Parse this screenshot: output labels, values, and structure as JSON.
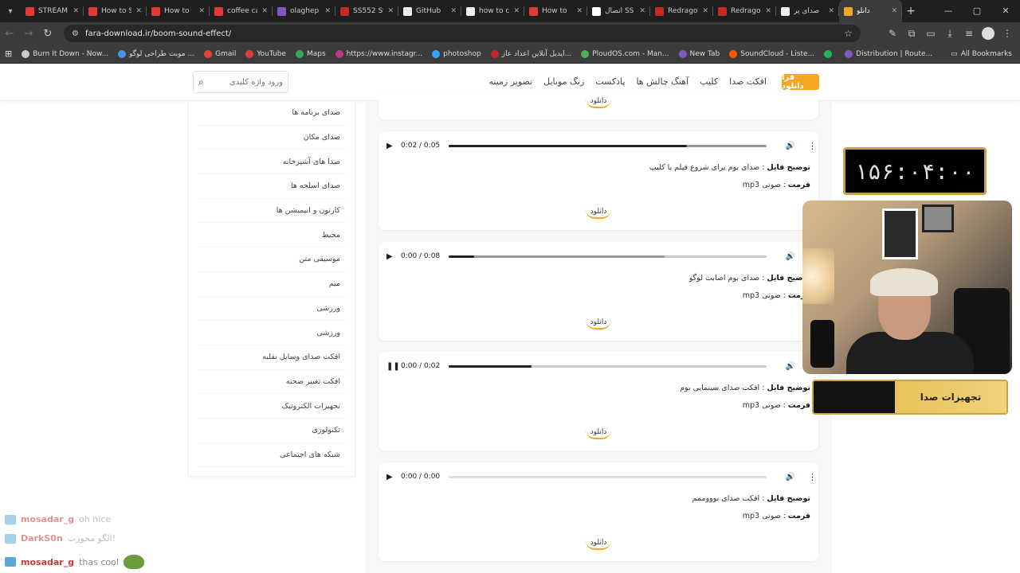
{
  "browser": {
    "tabs": [
      {
        "title": "STREAM",
        "color": "#e53935"
      },
      {
        "title": "How to S",
        "color": "#e53935"
      },
      {
        "title": "How to",
        "color": "#e53935"
      },
      {
        "title": "coffee ca",
        "color": "#e53935"
      },
      {
        "title": "olaghep",
        "color": "#7e57c2"
      },
      {
        "title": "SS552 St",
        "color": "#c62828"
      },
      {
        "title": "GitHub",
        "color": "#eeeeee"
      },
      {
        "title": "how to c",
        "color": "#eeeeee"
      },
      {
        "title": "How to",
        "color": "#e53935"
      },
      {
        "title": "اتصال SS",
        "color": "#ffffff"
      },
      {
        "title": "Redrago",
        "color": "#c62828"
      },
      {
        "title": "Redrago",
        "color": "#c62828"
      },
      {
        "title": "صدای پر",
        "color": "#eeeeee"
      },
      {
        "title": "دانلو",
        "color": "#f5a623",
        "active": true
      }
    ],
    "url": "fara-download.ir/boom-sound-effect/",
    "bookmarks": [
      {
        "label": "Burn It Down - Now...",
        "color": "#cccccc"
      },
      {
        "label": "موبت طراحی لوگو ...",
        "color": "#4a90e2"
      },
      {
        "label": "Gmail",
        "color": "#ea4335"
      },
      {
        "label": "YouTube",
        "color": "#e53935"
      },
      {
        "label": "Maps",
        "color": "#34a853"
      },
      {
        "label": "https://www.instagr...",
        "color": "#c13584"
      },
      {
        "label": "photoshop",
        "color": "#31a8ff"
      },
      {
        "label": "ایدیل آنلاین اعداد عاز...",
        "color": "#c62828"
      },
      {
        "label": "PloudOS.com - Man...",
        "color": "#4caf50"
      },
      {
        "label": "New Tab",
        "color": "#7e57c2"
      },
      {
        "label": "SoundCloud - Liste...",
        "color": "#ff5500"
      },
      {
        "label": "",
        "color": "#1db954"
      },
      {
        "label": "Distribution | Route...",
        "color": "#7e57c2"
      }
    ],
    "all_bookmarks": "All Bookmarks"
  },
  "site": {
    "logo": "فرا دانلود",
    "nav": [
      "افکت صدا",
      "کلیپ",
      "آهنگ چالش ها",
      "پادکست",
      "زنگ موبایل",
      "تصویر زمینه"
    ],
    "search_placeholder": "ورود واژه کلیدی"
  },
  "sidebar": {
    "items": [
      "صدای برنامه ها",
      "صدای مکان",
      "صدا های آشپزخانه",
      "صدای اسلحه ها",
      "کارتون و انیمیشن ها",
      "محیط",
      "موسیقی متن",
      "میم",
      "ورزشی",
      "ورزشی",
      "افکت صدای وسایل نقلیه",
      "افکت تغییر صحنه",
      "تجهیزات الکترونیک",
      "تکنولوژی",
      "شبکه های اجتماعی"
    ]
  },
  "cards": [
    {
      "time": "0:02 / 0:05",
      "progress": 0.75,
      "buffered": 1.0,
      "playing": false,
      "disabled": false,
      "desc_label": "توضیح فایل",
      "desc": "صدای بوم برای شروع فیلم یا کلیپ",
      "format_label": "فرمت",
      "format": "صوتی mp3",
      "download": "دانلود"
    },
    {
      "time": "0:00 / 0:08",
      "progress": 0.08,
      "buffered": 0.68,
      "playing": false,
      "disabled": false,
      "desc_label": "توضیح فایل",
      "desc": "صدای بوم اصابت لوگو",
      "format_label": "فرمت",
      "format": "صوتی mp3",
      "download": "دانلود"
    },
    {
      "time": "0:00 / 0:02",
      "progress": 0.26,
      "buffered": 0.26,
      "playing": true,
      "disabled": false,
      "desc_label": "توضیح فایل",
      "desc": "افکت صدای سینمایی بوم",
      "format_label": "فرمت",
      "format": "صوتی mp3",
      "download": "دانلود"
    },
    {
      "time": "0:00 / 0:00",
      "progress": 0,
      "buffered": 0,
      "playing": false,
      "disabled": true,
      "desc_label": "توضیح فایل",
      "desc": "افکت صدای بوووممم",
      "format_label": "فرمت",
      "format": "صوتی mp3",
      "download": "دانلود"
    }
  ],
  "top_download": "دانلود",
  "overlay": {
    "timer": "۱۵۶:۰۴:۰۰",
    "banner": "تجهیزات صدا"
  },
  "chat": [
    {
      "user": "mosadar_g",
      "msg": "oh nice",
      "faded": true
    },
    {
      "user": "DarkS0n",
      "msg": "الگو محورت!",
      "faded": true
    },
    {
      "user": "mosadar_g",
      "msg": "thas cool",
      "faded": false
    }
  ]
}
